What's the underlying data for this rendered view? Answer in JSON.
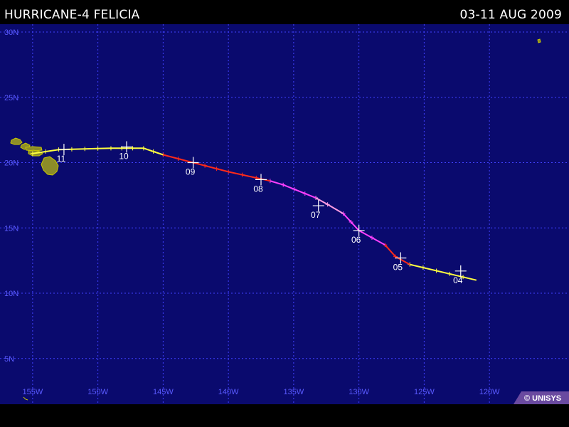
{
  "header": {
    "title": "HURRICANE-4 FELICIA",
    "dates": "03-11 AUG 2009"
  },
  "map": {
    "lon_labels": [
      "155W",
      "150W",
      "145W",
      "140W",
      "135W",
      "130W",
      "125W",
      "120W"
    ],
    "lat_labels": [
      "30N",
      "25N",
      "20N",
      "15N",
      "10N",
      "5N"
    ],
    "colors": {
      "ocean": "#0a0a6e",
      "grid": "#4040ff",
      "label": "#5a5aff",
      "land": "#8c8c28",
      "land_edge": "#c8c800"
    }
  },
  "track": {
    "intensity_colors": {
      "TS": "#ffff40",
      "H1": "#ff2a1a",
      "H3": "#ff40ff",
      "H4": "#ff9de2"
    },
    "segments": [
      {
        "stage": "TS",
        "points": [
          [
            -121.0,
            11.0
          ],
          [
            -126.1,
            12.2
          ]
        ]
      },
      {
        "stage": "H1",
        "points": [
          [
            -126.1,
            12.2
          ],
          [
            -127.2,
            12.8
          ],
          [
            -128.0,
            13.7
          ]
        ]
      },
      {
        "stage": "H3",
        "points": [
          [
            -128.0,
            13.7
          ],
          [
            -130.0,
            14.8
          ],
          [
            -131.2,
            16.1
          ]
        ]
      },
      {
        "stage": "H4",
        "points": [
          [
            -131.2,
            16.1
          ],
          [
            -132.4,
            16.8
          ],
          [
            -133.3,
            17.3
          ]
        ]
      },
      {
        "stage": "H3",
        "points": [
          [
            -133.3,
            17.3
          ],
          [
            -135.8,
            18.3
          ],
          [
            -136.8,
            18.6
          ]
        ]
      },
      {
        "stage": "H1",
        "points": [
          [
            -136.8,
            18.6
          ],
          [
            -140.0,
            19.3
          ],
          [
            -142.7,
            20.0
          ],
          [
            -145.0,
            20.6
          ]
        ]
      },
      {
        "stage": "TS",
        "points": [
          [
            -145.0,
            20.6
          ],
          [
            -146.5,
            21.1
          ],
          [
            -149.0,
            21.1
          ],
          [
            -153.0,
            21.0
          ],
          [
            -155.0,
            20.7
          ]
        ]
      }
    ],
    "markers": [
      {
        "lon": -122.2,
        "lat": 11.7,
        "day": "04"
      },
      {
        "lon": -126.8,
        "lat": 12.7,
        "day": "05"
      },
      {
        "lon": -130.0,
        "lat": 14.8,
        "day": "06"
      },
      {
        "lon": -133.1,
        "lat": 16.7,
        "day": "07"
      },
      {
        "lon": -137.5,
        "lat": 18.7,
        "day": "08"
      },
      {
        "lon": -142.7,
        "lat": 20.0,
        "day": "09"
      },
      {
        "lon": -147.8,
        "lat": 21.2,
        "day": "10"
      },
      {
        "lon": -152.6,
        "lat": 21.0,
        "day": "11"
      }
    ]
  },
  "credit": {
    "text": "© UNISYS"
  }
}
